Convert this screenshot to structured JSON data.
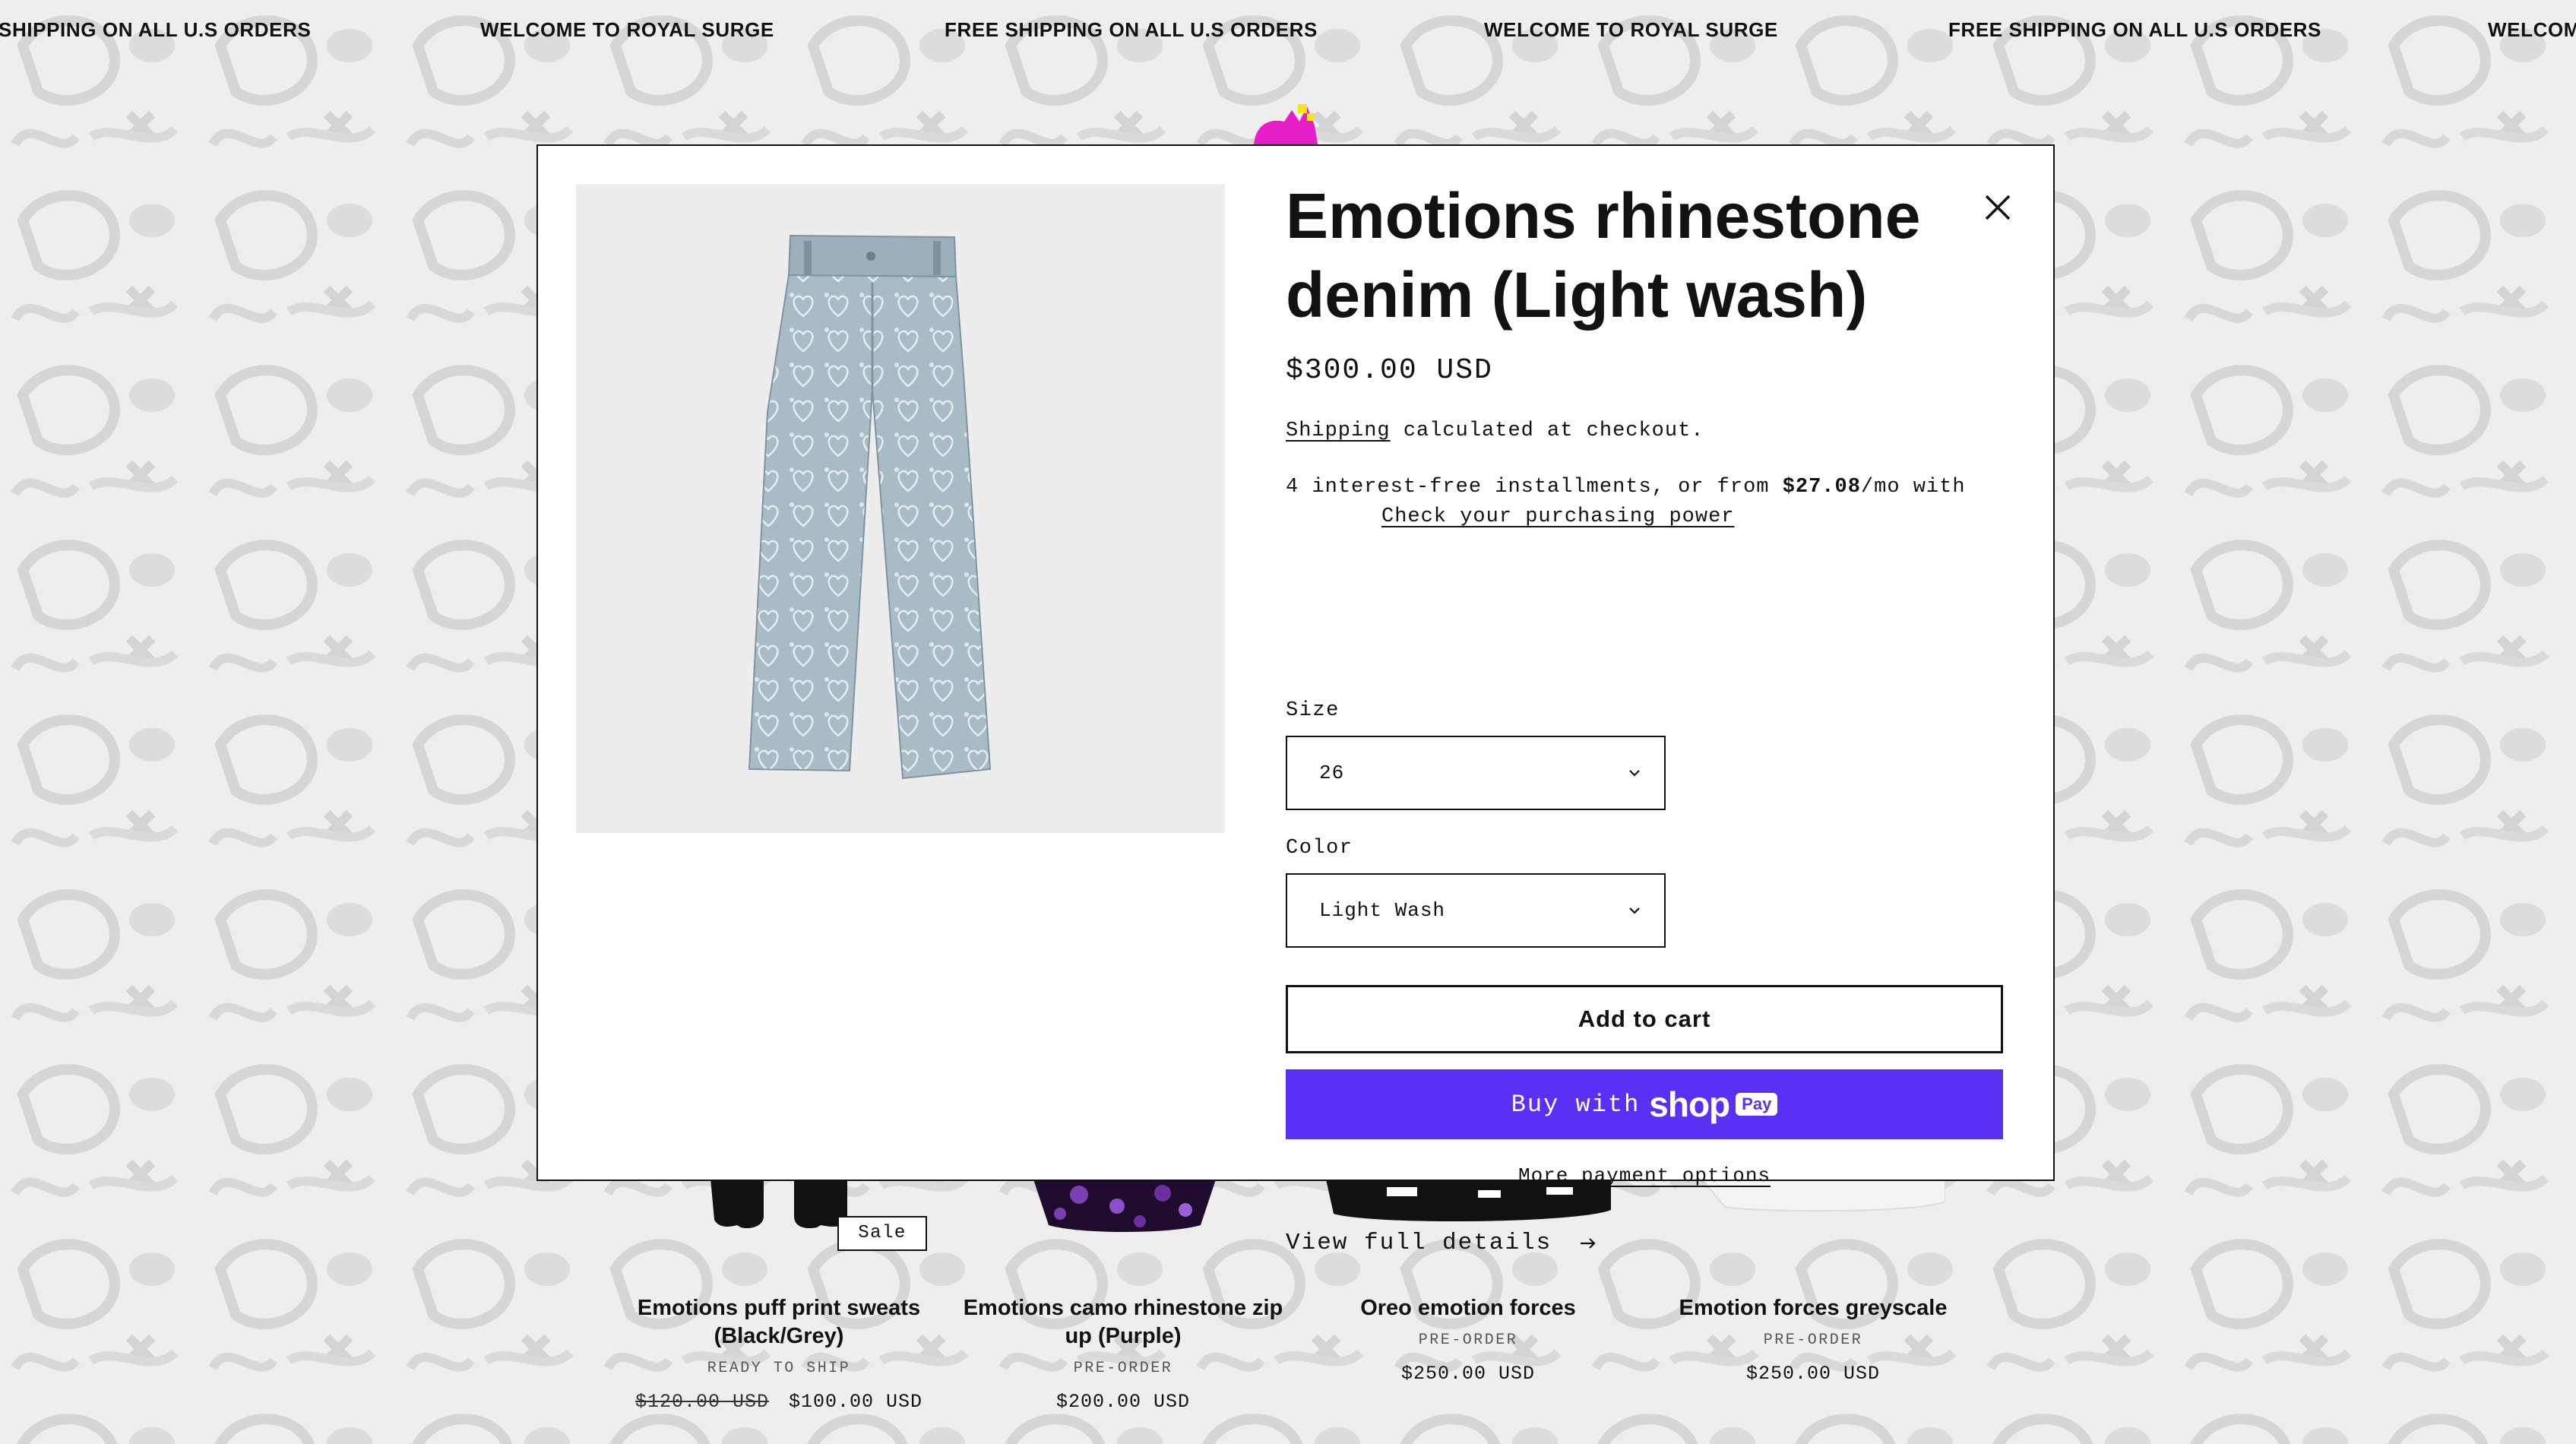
{
  "announcement": {
    "messages": [
      "SHIPPING ON ALL U.S ORDERS",
      "WELCOME TO ROYAL SURGE",
      "FREE SHIPPING ON ALL U.S ORDERS",
      "WELCOME TO ROYAL SURGE",
      "FREE SHIPPING ON ALL U.S ORDERS",
      "WELCOM"
    ]
  },
  "colors": {
    "accent_shop": "#5a31f4",
    "text": "#121212",
    "border": "#111111"
  },
  "modal": {
    "title": "Emotions rhinestone denim (Light wash)",
    "price": "$300.00 USD",
    "shipping_link": "Shipping",
    "shipping_rest": " calculated at checkout.",
    "installments_prefix": "4 interest-free installments, or from ",
    "installments_amount": "$27.08",
    "installments_suffix": "/mo with",
    "check_power": "Check your purchasing power",
    "size_label": "Size",
    "size_value": "26",
    "color_label": "Color",
    "color_value": "Light Wash",
    "add_to_cart": "Add to cart",
    "buy_with": "Buy with",
    "shop_brand": "shop",
    "shop_pay_badge": "Pay",
    "more_payment": "More payment options",
    "view_details": "View full details",
    "icons": {
      "close": "close-icon",
      "chevron": "chevron-down-icon",
      "arrow": "arrow-right-icon"
    }
  },
  "products": [
    {
      "title": "Emotions puff print sweats (Black/Grey)",
      "status": "READY TO SHIP",
      "old_price": "$120.00 USD",
      "price": "$100.00 USD",
      "badge": "Sale"
    },
    {
      "title": "Emotions camo rhinestone zip up (Purple)",
      "status": "PRE-ORDER",
      "price": "$200.00 USD"
    },
    {
      "title": "Oreo emotion forces",
      "status": "PRE-ORDER",
      "price": "$250.00 USD"
    },
    {
      "title": "Emotion forces greyscale",
      "status": "PRE-ORDER",
      "price": "$250.00 USD"
    }
  ]
}
